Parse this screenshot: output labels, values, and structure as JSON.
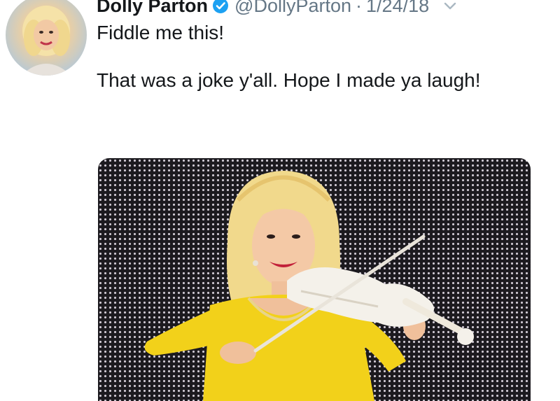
{
  "tweet": {
    "author_name": "Dolly Parton",
    "handle": "@DollyParton",
    "separator": "·",
    "date": "1/24/18",
    "verified_icon": "verified-badge-icon",
    "menu_icon": "chevron-down-icon",
    "text_line1": "Fiddle me this!",
    "text_line2": "That was a joke y'all. Hope I made ya laugh!"
  },
  "colors": {
    "text": "#14171a",
    "secondary": "#657786",
    "verified": "#1da1f2",
    "dress": "#f2d11a",
    "hair": "#f1d98c",
    "violin": "#f4f1ea",
    "backdrop": "#1c1a1f"
  }
}
